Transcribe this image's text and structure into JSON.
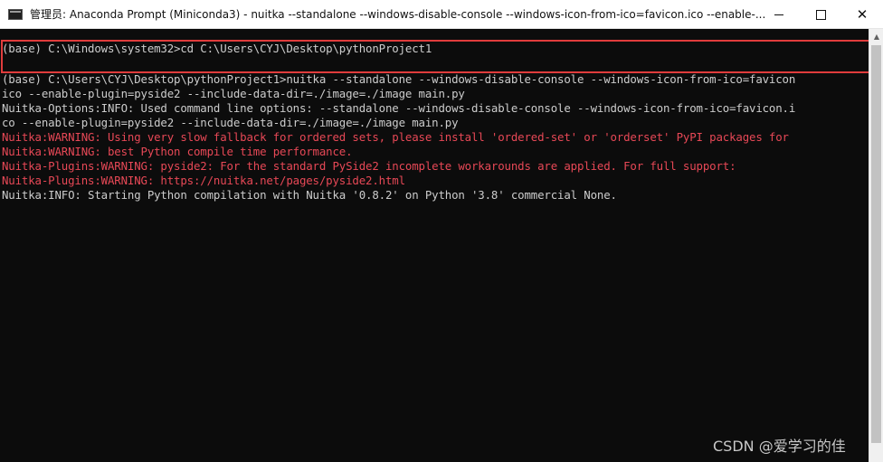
{
  "window": {
    "title": "管理员: Anaconda Prompt (Miniconda3) - nuitka  --standalone --windows-disable-console --windows-icon-from-ico=favicon.ico --enable-..."
  },
  "console": {
    "lines": [
      {
        "text": "(base) C:\\Windows\\system32>cd C:\\Users\\CYJ\\Desktop\\pythonProject1",
        "color": "#cccccc"
      },
      {
        "text": "",
        "color": "#cccccc"
      },
      {
        "text": "(base) C:\\Users\\CYJ\\Desktop\\pythonProject1>nuitka --standalone --windows-disable-console --windows-icon-from-ico=favicon",
        "color": "#cccccc"
      },
      {
        "text": "ico --enable-plugin=pyside2 --include-data-dir=./image=./image main.py",
        "color": "#cccccc"
      },
      {
        "text": "Nuitka-Options:INFO: Used command line options: --standalone --windows-disable-console --windows-icon-from-ico=favicon.i",
        "color": "#cccccc"
      },
      {
        "text": "co --enable-plugin=pyside2 --include-data-dir=./image=./image main.py",
        "color": "#cccccc"
      },
      {
        "text": "Nuitka:WARNING: Using very slow fallback for ordered sets, please install 'ordered-set' or 'orderset' PyPI packages for",
        "color": "#e74856"
      },
      {
        "text": "Nuitka:WARNING: best Python compile time performance.",
        "color": "#e74856"
      },
      {
        "text": "Nuitka-Plugins:WARNING: pyside2: For the standard PySide2 incomplete workarounds are applied. For full support:",
        "color": "#e74856"
      },
      {
        "text": "Nuitka-Plugins:WARNING: https://nuitka.net/pages/pyside2.html",
        "color": "#e74856"
      },
      {
        "text": "Nuitka:INFO: Starting Python compilation with Nuitka '0.8.2' on Python '3.8' commercial None.",
        "color": "#cccccc"
      }
    ]
  },
  "highlight": {
    "color": "#e03c3c"
  },
  "watermark": "CSDN @爱学习的佳",
  "icons": {
    "app": "console-app-icon",
    "minimize": "minimize-icon",
    "maximize": "maximize-icon",
    "close": "close-icon",
    "scroll_up": "scroll-up-arrow-icon"
  }
}
